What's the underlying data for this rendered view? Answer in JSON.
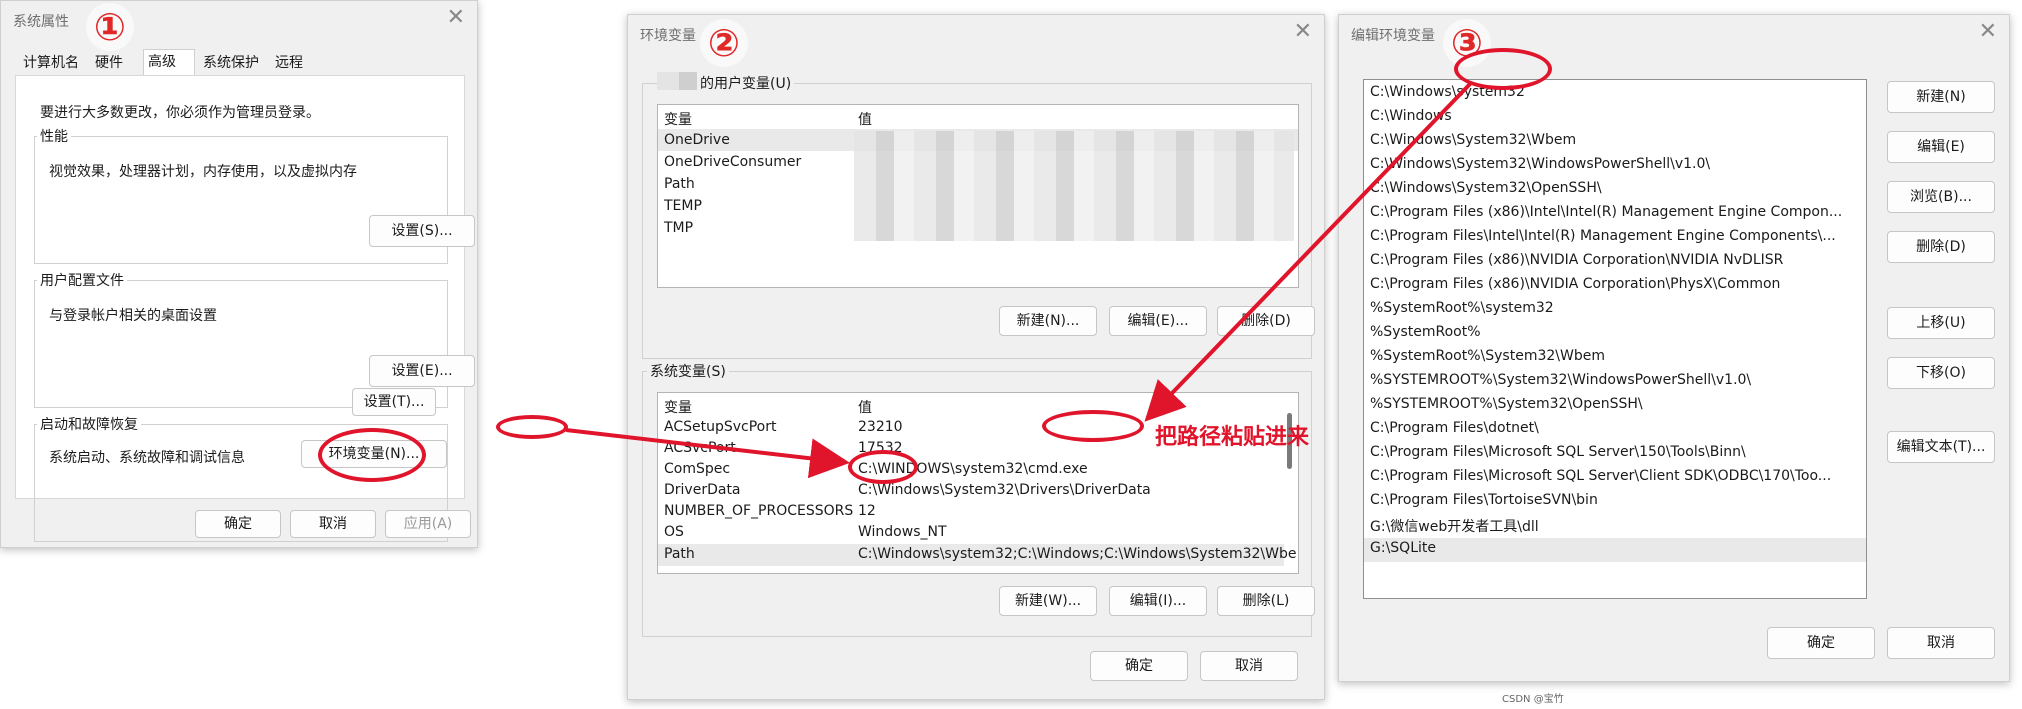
{
  "w1": {
    "title": "系统属性",
    "step": "①",
    "tabs": [
      "计算机名",
      "硬件",
      "高级",
      "系统保护",
      "远程"
    ],
    "admin_note": "要进行大多数更改，你必须作为管理员登录。",
    "perf": {
      "label": "性能",
      "desc": "视觉效果，处理器计划，内存使用，以及虚拟内存",
      "btn": "设置(S)..."
    },
    "profile": {
      "label": "用户配置文件",
      "desc": "与登录帐户相关的桌面设置",
      "btn": "设置(E)..."
    },
    "startup": {
      "label": "启动和故障恢复",
      "desc": "系统启动、系统故障和调试信息",
      "btn": "设置(T)..."
    },
    "env_btn": "环境变量(N)...",
    "ok": "确定",
    "cancel": "取消",
    "apply": "应用(A)"
  },
  "w2": {
    "title": "环境变量",
    "step": "②",
    "user_group": "的用户变量(U)",
    "col_var": "变量",
    "col_val": "值",
    "user_vars": [
      "OneDrive",
      "OneDriveConsumer",
      "Path",
      "TEMP",
      "TMP"
    ],
    "user_btns": [
      "新建(N)...",
      "编辑(E)...",
      "删除(D)"
    ],
    "sys_group": "系统变量(S)",
    "sys_vars": [
      {
        "name": "ACSetupSvcPort",
        "value": "23210"
      },
      {
        "name": "ACSvcPort",
        "value": "17532"
      },
      {
        "name": "ComSpec",
        "value": "C:\\WINDOWS\\system32\\cmd.exe"
      },
      {
        "name": "DriverData",
        "value": "C:\\Windows\\System32\\Drivers\\DriverData"
      },
      {
        "name": "NUMBER_OF_PROCESSORS",
        "value": "12"
      },
      {
        "name": "OS",
        "value": "Windows_NT"
      },
      {
        "name": "Path",
        "value": "C:\\Windows\\system32;C:\\Windows;C:\\Windows\\System32\\Wbe..."
      }
    ],
    "sys_btns": [
      "新建(W)...",
      "编辑(I)...",
      "删除(L)"
    ],
    "ok": "确定",
    "cancel": "取消"
  },
  "w3": {
    "title": "编辑环境变量",
    "step": "③",
    "paths": [
      "C:\\Windows\\system32",
      "C:\\Windows",
      "C:\\Windows\\System32\\Wbem",
      "C:\\Windows\\System32\\WindowsPowerShell\\v1.0\\",
      "C:\\Windows\\System32\\OpenSSH\\",
      "C:\\Program Files (x86)\\Intel\\Intel(R) Management Engine Compon...",
      "C:\\Program Files\\Intel\\Intel(R) Management Engine Components\\...",
      "C:\\Program Files (x86)\\NVIDIA Corporation\\NVIDIA NvDLISR",
      "C:\\Program Files (x86)\\NVIDIA Corporation\\PhysX\\Common",
      "%SystemRoot%\\system32",
      "%SystemRoot%",
      "%SystemRoot%\\System32\\Wbem",
      "%SYSTEMROOT%\\System32\\WindowsPowerShell\\v1.0\\",
      "%SYSTEMROOT%\\System32\\OpenSSH\\",
      "C:\\Program Files\\dotnet\\",
      "C:\\Program Files\\Microsoft SQL Server\\150\\Tools\\Binn\\",
      "C:\\Program Files\\Microsoft SQL Server\\Client SDK\\ODBC\\170\\Too...",
      "C:\\Program Files\\TortoiseSVN\\bin",
      "G:\\微信web开发者工具\\dll",
      "G:\\SQLite"
    ],
    "btns": [
      "新建(N)",
      "编辑(E)",
      "浏览(B)...",
      "删除(D)",
      "上移(U)",
      "下移(O)",
      "编辑文本(T)..."
    ],
    "ok": "确定",
    "cancel": "取消"
  },
  "annotation": "把路径粘贴进来",
  "watermark": "CSDN @宝竹",
  "colors": {
    "highlight": "#e0142a",
    "bg": "#f0f0f0"
  }
}
